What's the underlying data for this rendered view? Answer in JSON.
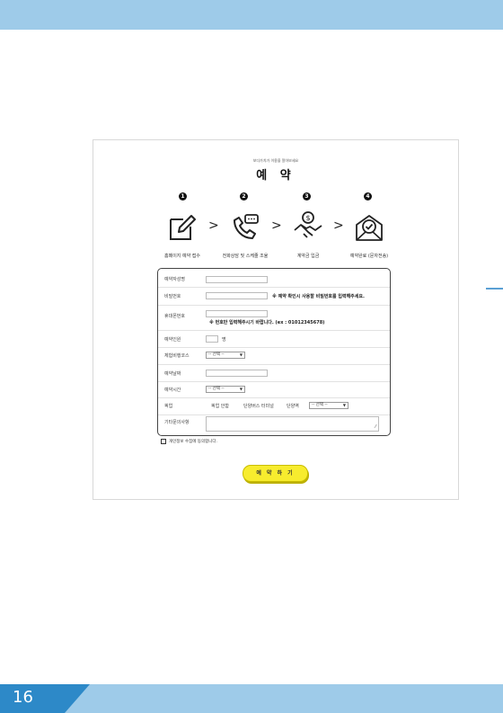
{
  "page_number": "16",
  "header": {
    "subtitle": "보다가치가 이용을 알아보세요",
    "title": "예 약"
  },
  "steps": [
    {
      "num": "1",
      "icon": "pencil-edit-icon",
      "label": "홈페이지 예약 접수"
    },
    {
      "num": "2",
      "icon": "phone-call-icon",
      "label": "전화상담 및 스케줄 조율"
    },
    {
      "num": "3",
      "icon": "payment-handshake-icon",
      "label": "계약금 입금"
    },
    {
      "num": "4",
      "icon": "mail-check-icon",
      "label": "예약완료 (문자전송)"
    }
  ],
  "chevron": ">",
  "form": {
    "name_label": "예약자성명",
    "password_label": "비밀번호",
    "password_note": "※ 예약 확인시 사용할 비밀번호를 입력해주세요.",
    "phone_label": "휴대폰번호",
    "phone_note": "※ 번호만 입력해주시기 바랍니다. (ex : 01012345678)",
    "people_label": "예약인원",
    "people_unit": "명",
    "course_label": "체험비행코스",
    "course_value": "-- 선택 --",
    "date_label": "예약날짜",
    "time_label": "예약시간",
    "time_value": "-- 선택 --",
    "pickup_label": "픽업",
    "pickup_option1": "픽업 안함",
    "pickup_option2": "단양버스 터미널",
    "pickup_option3": "단양역",
    "pickup_value": "-- 선택 --",
    "notes_label": "기타문의사항"
  },
  "consent_label": "개인정보 수집에 동의합니다.",
  "submit_label": "예 약 하 기",
  "colors": {
    "band": "#9ecbe9",
    "page_tab": "#2d89c8",
    "submit_bg": "#f7ec2e"
  }
}
